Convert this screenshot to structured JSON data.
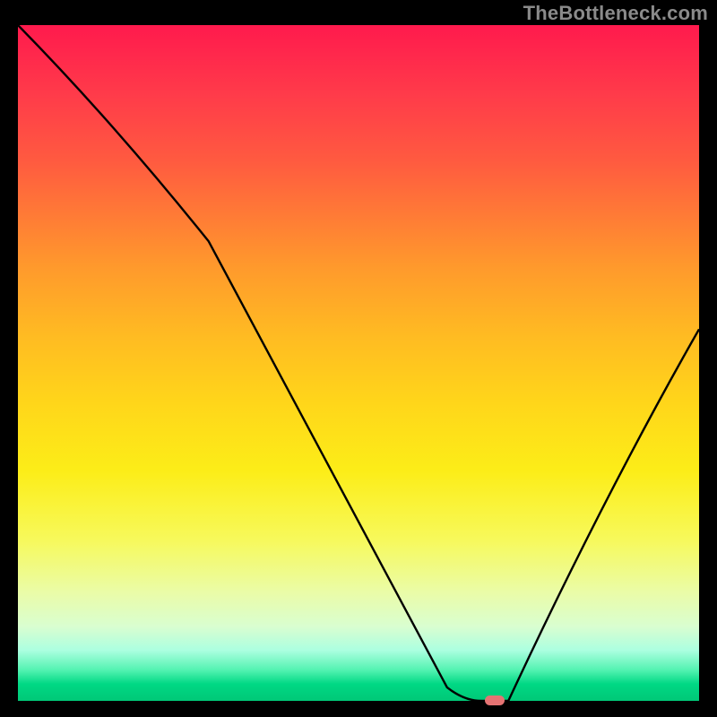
{
  "watermark": "TheBottleneck.com",
  "chart_data": {
    "type": "line",
    "title": "",
    "xlabel": "",
    "ylabel": "",
    "xlim": [
      0,
      100
    ],
    "ylim": [
      0,
      100
    ],
    "grid": false,
    "series": [
      {
        "name": "curve",
        "x": [
          0,
          28,
          63,
          68,
          72,
          100
        ],
        "values": [
          100,
          68,
          2,
          0,
          0,
          55
        ]
      }
    ],
    "marker": {
      "x": 70,
      "y": 0,
      "color": "#e57373"
    },
    "background_gradient": {
      "top": "#ff1a4d",
      "bottom": "#00c877"
    }
  }
}
